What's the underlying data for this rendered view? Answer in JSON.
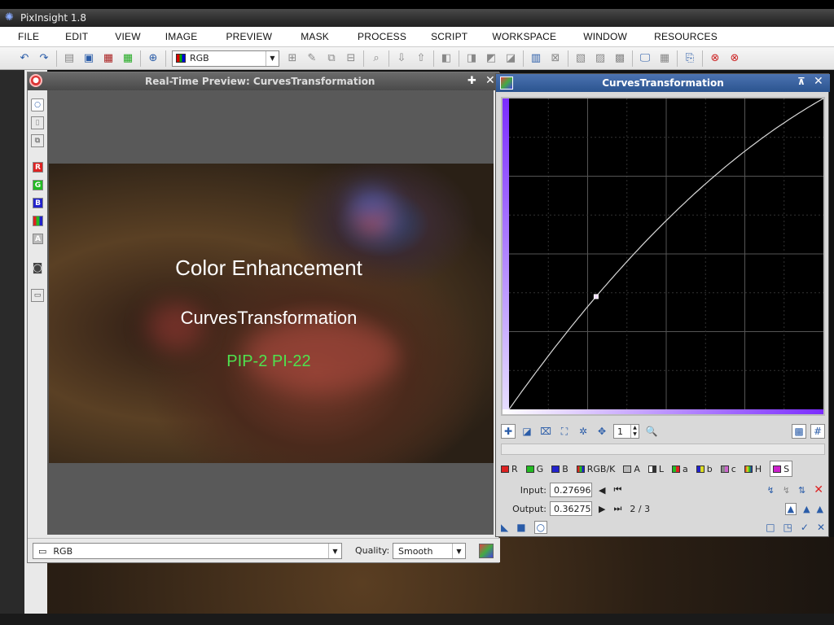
{
  "app": {
    "title": "PixInsight 1.8"
  },
  "menu": [
    "FILE",
    "EDIT",
    "VIEW",
    "IMAGE",
    "PREVIEW",
    "MASK",
    "PROCESS",
    "SCRIPT",
    "WORKSPACE",
    "WINDOW",
    "RESOURCES"
  ],
  "toolbar": {
    "view_combo": "RGB"
  },
  "preview": {
    "title": "Real-Time Preview: CurvesTransformation",
    "overlay_title": "Color Enhancement",
    "overlay_subtitle": "CurvesTransformation",
    "overlay_tag": "PIP-2 PI-22",
    "bottom_combo": "RGB",
    "quality_label": "Quality:",
    "quality_value": "Smooth",
    "side_buttons": [
      "R",
      "G",
      "B",
      "A"
    ]
  },
  "curves": {
    "title": "CurvesTransformation",
    "zoom_value": "1",
    "channels": [
      "R",
      "G",
      "B",
      "RGB/K",
      "A",
      "L",
      "a",
      "b",
      "c",
      "H",
      "S"
    ],
    "selected_channel": "S",
    "input_label": "Input:",
    "input_value": "0.27696",
    "output_label": "Output:",
    "output_value": "0.36275",
    "point_counter": "2 / 3",
    "curve_points": [
      [
        0,
        0
      ],
      [
        0.27696,
        0.36275
      ],
      [
        1,
        1
      ]
    ]
  },
  "colors": {
    "title_bar": "#2b548f",
    "accent": "#2a5ca8",
    "close_red": "#d33",
    "overlay_green": "#4ee24e"
  }
}
